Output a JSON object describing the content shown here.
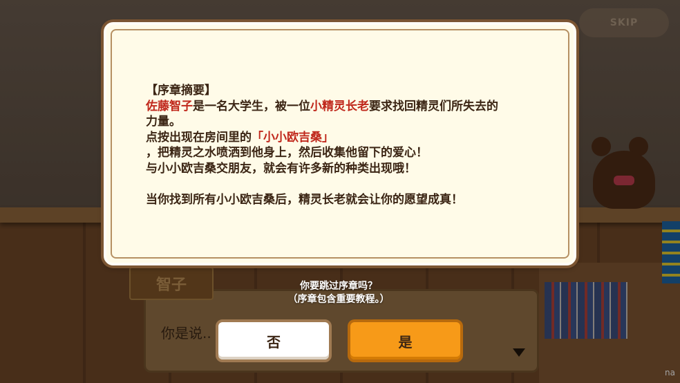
{
  "skip_label": "SKIP",
  "dialogue": {
    "speaker": "智子",
    "text": "你是说.."
  },
  "corner_text": "na",
  "summary": {
    "heading": "【序章摘要】",
    "line1": {
      "name1": "佐藤智子",
      "mid": "是一名大学生，被一位",
      "name2": "小精灵长老",
      "tail": "要求找回精灵们所失去的"
    },
    "line2": "力量。",
    "line3": {
      "pre": "点按出现在房间里的",
      "name": "「小小欧吉桑」"
    },
    "line4": "，把精灵之水喷洒到他身上，然后收集他留下的爱心！",
    "line5": "与小小欧吉桑交朋友，就会有许多新的种类出现哦！",
    "line6": "当你找到所有小小欧吉桑后，精灵长老就会让你的愿望成真！"
  },
  "confirm": {
    "question": "你要跳过序章吗？",
    "note": "（序章包含重要教程。）",
    "no_label": "否",
    "yes_label": "是"
  },
  "colors": {
    "highlight": "#c0281c",
    "panel_bg": "#fffbe8",
    "yes_button": "#f79a18",
    "panel_border": "#7b5532"
  },
  "icons": {
    "dialog_advance": "triangle-down-icon",
    "teddy_bear": "teddy-bear-decoration"
  }
}
